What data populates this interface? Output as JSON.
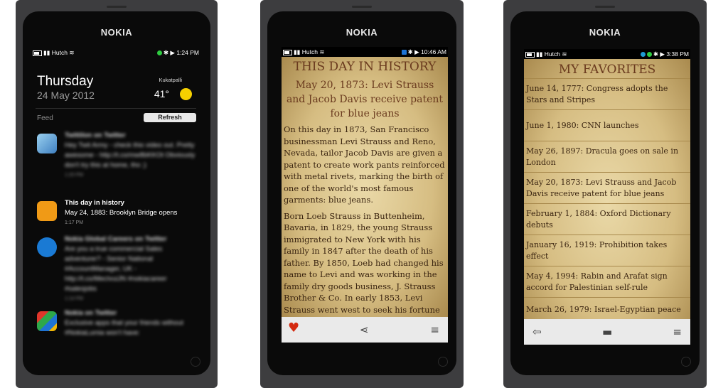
{
  "brand": "NOKIA",
  "phone1": {
    "status": {
      "carrier": "Hutch",
      "time": "1:24 PM"
    },
    "day": "Thursday",
    "date": "24 May 2012",
    "weather": {
      "city": "Kukatpalli",
      "temp": "41°"
    },
    "feed_label": "Feed",
    "refresh_label": "Refresh",
    "feed": [
      {
        "title": "Twittilon on Twitter",
        "text": "Hey Twit Army - check this video out. Pretty awesome - http://t.co/mw8bKKOt Obviously don't try this at home, tho ;)",
        "time": "1:20 PM",
        "blurred": true
      },
      {
        "title": "This day in history",
        "text": "May 24, 1883: Brooklyn Bridge opens",
        "time": "1:17 PM",
        "blurred": false
      },
      {
        "title": "Nokia Global Careers on Twitter",
        "text": "Are you a true commercial Sales adventurer? - Senior National #AccountManager, UK - http://t.co/MecIvuiJN #nokiacareer #salesjobs",
        "time": "1:14 PM",
        "blurred": true
      },
      {
        "title": "Nokia on Twitter",
        "text": "Exclusive apps that your friends without #NokiaLumia won't have:",
        "time": "",
        "blurred": true
      }
    ]
  },
  "phone2": {
    "status": {
      "carrier": "Hutch",
      "time": "10:46 AM"
    },
    "title": "THIS DAY IN HISTORY",
    "headline": "May 20, 1873: Levi Strauss and Jacob Davis receive patent for blue jeans",
    "paragraphs": [
      "On this day in 1873, San Francisco businessman Levi Strauss and Reno, Nevada, tailor Jacob Davis are given a patent to create work pants reinforced with metal rivets, marking the birth of one of the world's most famous garments: blue jeans.",
      "Born Loeb Strauss in Buttenheim, Bavaria, in 1829, the young Strauss immigrated to New York with his family in 1847 after the death of his father. By 1850, Loeb had changed his name to Levi and was working in the family dry goods business, J. Strauss Brother & Co. In early 1853, Levi Strauss went west to seek his fortune during the heady days"
    ],
    "toolbar": {
      "heart": "heart-icon",
      "share": "share-icon",
      "menu": "menu-icon"
    }
  },
  "phone3": {
    "status": {
      "carrier": "Hutch",
      "time": "3:38 PM"
    },
    "title": "MY FAVORITES",
    "favorites": [
      "June 14, 1777: Congress adopts the Stars and Stripes",
      "June 1, 1980: CNN launches",
      "May 26, 1897: Dracula goes on sale in London",
      "May 20, 1873: Levi Strauss and Jacob Davis receive patent for blue jeans",
      "February 1, 1884: Oxford Dictionary debuts",
      "January 16, 1919: Prohibition takes effect",
      "May 4, 1994: Rabin and Arafat sign accord for Palestinian self-rule",
      "March 26, 1979: Israel-Egyptian peace"
    ],
    "toolbar": {
      "back": "back-icon",
      "delete": "trash-icon",
      "menu": "menu-icon"
    }
  },
  "colors": {
    "paper": "#dcc48c",
    "heading": "#6a3a1e",
    "heart": "#d42a10",
    "sun": "#f5d000",
    "toolbar": "#eaeaea"
  }
}
